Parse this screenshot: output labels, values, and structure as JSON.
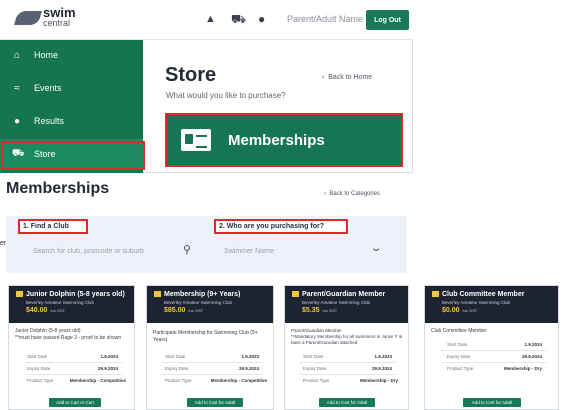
{
  "header": {
    "logo_top": "swim",
    "logo_bottom": "central",
    "user_name": "Parent/Adult Name",
    "logout_label": "Log Out"
  },
  "sidebar": {
    "items": [
      {
        "label": "Home",
        "icon": "home-icon"
      },
      {
        "label": "Events",
        "icon": "swimmer-icon"
      },
      {
        "label": "Results",
        "icon": "medal-icon"
      },
      {
        "label": "Store",
        "icon": "cart-icon"
      }
    ]
  },
  "store": {
    "title": "Store",
    "subtitle": "What would you like to purchase?",
    "back_link": "Back to Home",
    "tile_label": "Memberships"
  },
  "memberships": {
    "title": "Memberships",
    "back_link": "Back to Categories",
    "find_club_label": "1. Find a Club",
    "who_label": "2. Who are you purchasing for?",
    "club_search_placeholder": "Search for club, postcode or suburb",
    "swimmer_placeholder": "Swimmer Name",
    "edge_text": "er"
  },
  "cards": [
    {
      "title": "Junior Dolphin (5-8 years old)",
      "club": "Beverley Amateur Swimming Club",
      "price": "$40.00",
      "price_note": "Inc GST",
      "desc": "Junior Dolphin (5-8 years old)\n**must have passed Rage 3 - proof to be shown",
      "start_label": "Start Date",
      "start": "1.9.2023",
      "expiry_label": "Expiry Date",
      "expiry": "29.9.2024",
      "type_label": "Product Type",
      "type": "Membership - Competitive",
      "button": "Add to Cart or Cart"
    },
    {
      "title": "Membership (9+ Years)",
      "club": "Beverley Amateur Swimming Club",
      "price": "$85.00",
      "price_note": "Inc GST",
      "desc": "Participate Membership for Swimming Club (9+ Years)",
      "start_label": "Start Date",
      "start": "1.9.2023",
      "expiry_label": "Expiry Date",
      "expiry": "29.9.2024",
      "type_label": "Product Type",
      "type": "Membership - Competitive",
      "button": "Add to Cart for Adult"
    },
    {
      "title": "Parent/Guardian Member",
      "club": "Beverley Amateur Swimming Club",
      "price": "$5.35",
      "price_note": "Inc GST",
      "desc": "Parent/Guardian Member\n**Mandatory Membership for all swimmers in Junior F & have a Parent/Guardian attached",
      "start_label": "Start Date",
      "start": "1.9.2023",
      "expiry_label": "Expiry Date",
      "expiry": "29.9.2024",
      "type_label": "Product Type",
      "type": "Membership - Dry",
      "button": "Add to Cart for Adult"
    },
    {
      "title": "Club Committee Member",
      "club": "Beverley Amateur Swimming Club",
      "price": "$0.00",
      "price_note": "Inc GST",
      "desc": "Club Committee Member",
      "start_label": "Start Date",
      "start": "1.9.2024",
      "expiry_label": "Expiry Date",
      "expiry": "29.9.2024",
      "type_label": "Product Type",
      "type": "Membership - Dry",
      "button": "Add to Cart for Adult"
    }
  ]
}
